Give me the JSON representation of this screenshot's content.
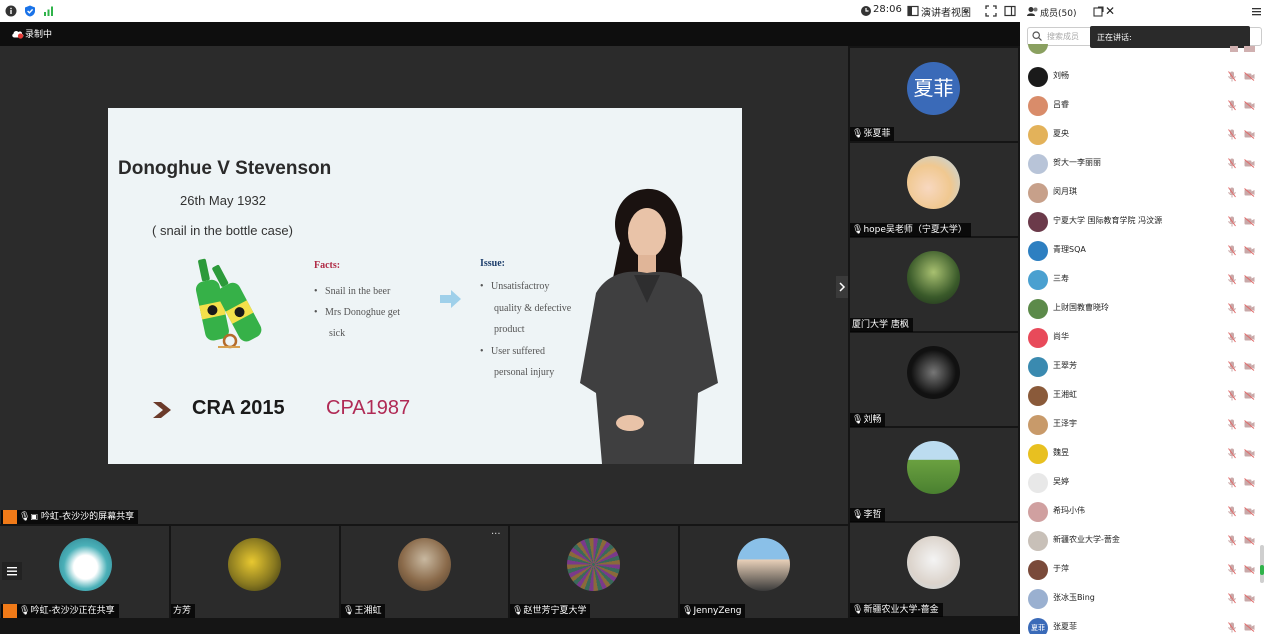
{
  "topbar": {
    "timer": "28:06",
    "view_mode": "演讲者视图",
    "members_tab": "成员(50)"
  },
  "recording": "录制中",
  "speaking_tooltip": "正在讲话:",
  "search_placeholder": "搜索成员",
  "slide": {
    "title": "Donoghue V Stevenson",
    "date": "26th May 1932",
    "subtitle": "( snail in the bottle case)",
    "facts_heading": "Facts:",
    "facts": [
      "Snail in the beer",
      "Mrs Donoghue get",
      "sick"
    ],
    "issue_heading": "Issue:",
    "issues": [
      "Unsatisfactroy",
      "quality & defective",
      "product",
      "User suffered",
      "personal injury"
    ],
    "cra": "CRA 2015",
    "cpa": "CPA1987"
  },
  "screen_share_label": "吟虹-衣沙沙的屏幕共享",
  "right_tiles": [
    {
      "avatar_text": "夏菲",
      "name": "张夏菲"
    },
    {
      "name": "hope吴老师（宁夏大学）"
    },
    {
      "name": "厦门大学 唐枫"
    },
    {
      "name": "刘畅"
    },
    {
      "name": "李哲"
    },
    {
      "name": "新疆农业大学-蔷金"
    }
  ],
  "bottom_tiles": [
    {
      "name": "吟虹-衣沙沙正在共享"
    },
    {
      "name": "方芳"
    },
    {
      "name": "王湘虹"
    },
    {
      "name": "赵世芳宁夏大学"
    },
    {
      "name": "JennyZeng"
    }
  ],
  "members": [
    {
      "name": "刘畅",
      "color": "#1a1a1a"
    },
    {
      "name": "吕睿",
      "color": "#d98c6a"
    },
    {
      "name": "夏央",
      "color": "#e3b25a"
    },
    {
      "name": "贺大一李丽丽",
      "color": "#b8c4d8"
    },
    {
      "name": "闵月琪",
      "color": "#c7a08a"
    },
    {
      "name": "宁夏大学 国际教育学院 冯汶源",
      "color": "#6b3a4a"
    },
    {
      "name": "青理SQA",
      "color": "#2d7fc1"
    },
    {
      "name": "三寿",
      "color": "#4aa0d0"
    },
    {
      "name": "上财国教曹晓玲",
      "color": "#5c8a4a"
    },
    {
      "name": "尚华",
      "color": "#e84a5a"
    },
    {
      "name": "王翠芳",
      "color": "#3a8ab0"
    },
    {
      "name": "王湘虹",
      "color": "#8a5a3a"
    },
    {
      "name": "王泽宇",
      "color": "#c89a6a"
    },
    {
      "name": "魏昱",
      "color": "#e8c020"
    },
    {
      "name": "吴婷",
      "color": "#e8e8e8"
    },
    {
      "name": "希玛小伟",
      "color": "#d0a0a0"
    },
    {
      "name": "新疆农业大学-蔷金",
      "color": "#c8c0b8"
    },
    {
      "name": "于萍",
      "color": "#7a4a3a"
    },
    {
      "name": "张冰玉Bing",
      "color": "#9ab0d0"
    },
    {
      "name": "张夏菲",
      "color": "#3a6ab8",
      "avatar_text": "夏菲"
    }
  ]
}
